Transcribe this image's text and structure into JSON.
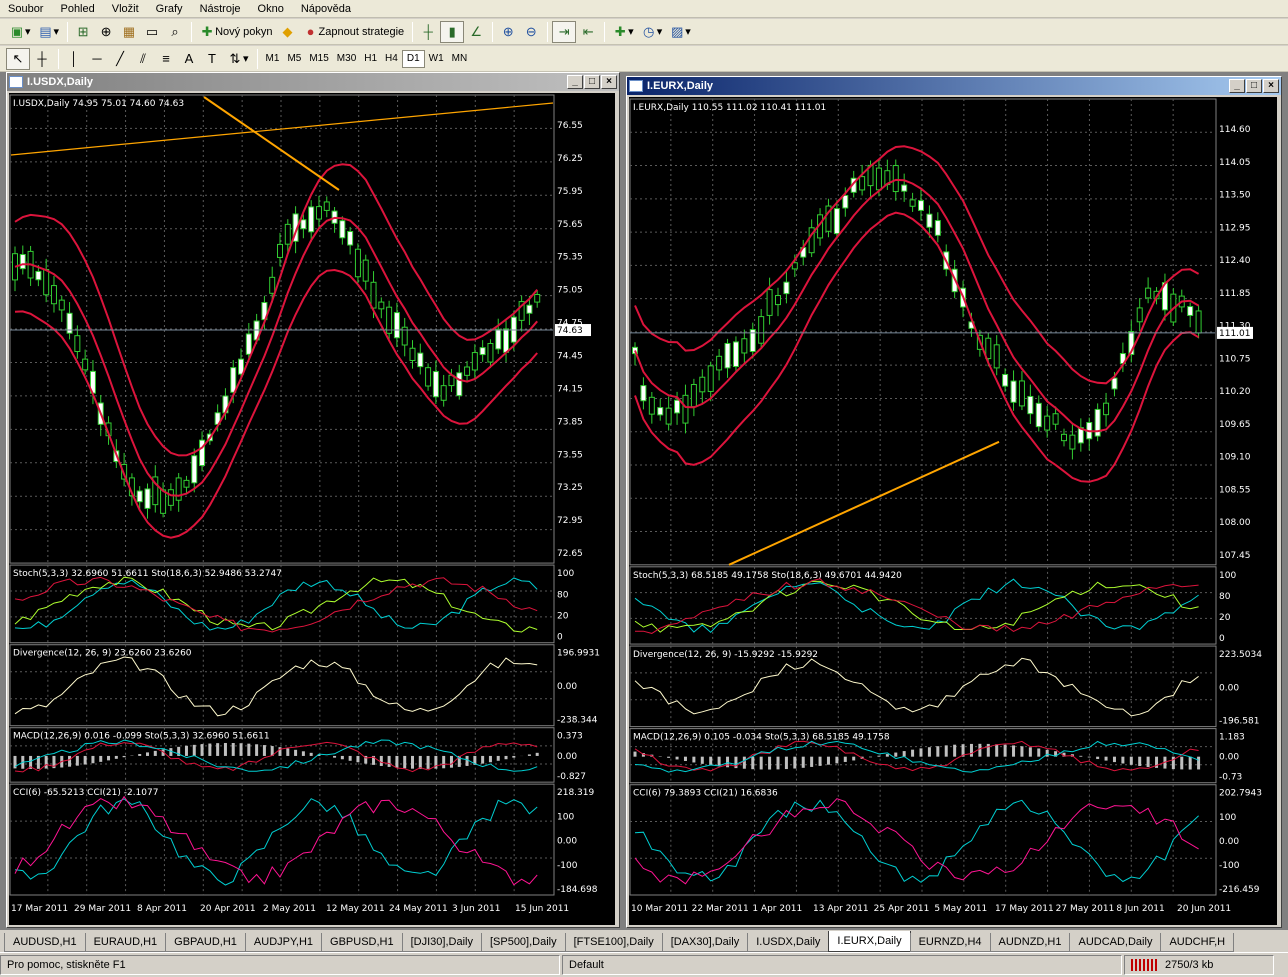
{
  "menu": [
    "Soubor",
    "Pohled",
    "Vložit",
    "Grafy",
    "Nástroje",
    "Okno",
    "Nápověda"
  ],
  "toolbar": {
    "new_order": "Nový pokyn",
    "autotrade": "Zapnout strategie"
  },
  "timeframes": [
    "M1",
    "M5",
    "M15",
    "M30",
    "H1",
    "H4",
    "D1",
    "W1",
    "MN"
  ],
  "active_timeframe": "D1",
  "windows": [
    {
      "title": "I.USDX,Daily",
      "active": false,
      "header": "I.USDX,Daily  74.95 75.01 74.60 74.63",
      "price_ticks": [
        "76.55",
        "76.25",
        "75.95",
        "75.65",
        "75.35",
        "75.05",
        "74.75",
        "74.45",
        "74.15",
        "73.85",
        "73.55",
        "73.25",
        "72.95",
        "72.65"
      ],
      "current_price": "74.63",
      "stoch_label": "Stoch(5,3,3) 32.6960 51.6611  Sto(18,6,3) 52.9486 53.2747",
      "stoch_ticks": [
        "100",
        "80",
        "20",
        "0"
      ],
      "div_label": "Divergence(12, 26, 9) 23.6260 23.6260",
      "div_ticks": [
        "196.9931",
        "0.00",
        "-238.344"
      ],
      "macd_label": "MACD(12,26,9) 0.016 -0.099  Sto(5,3,3) 32.6960 51.6611",
      "macd_ticks": [
        "0.373",
        "0.00",
        "-0.827"
      ],
      "cci_label": "CCI(6) -65.5213  CCI(21) -2.1077",
      "cci_ticks": [
        "218.319",
        "100",
        "0.00",
        "-100",
        "-184.698"
      ],
      "dates": [
        "17 Mar 2011",
        "29 Mar 2011",
        "8 Apr 2011",
        "20 Apr 2011",
        "2 May 2011",
        "12 May 2011",
        "24 May 2011",
        "3 Jun 2011",
        "15 Jun 2011"
      ]
    },
    {
      "title": "I.EURX,Daily",
      "active": true,
      "header": "I.EURX,Daily  110.55 111.02 110.41 111.01",
      "price_ticks": [
        "114.60",
        "114.05",
        "113.50",
        "112.95",
        "112.40",
        "111.85",
        "111.30",
        "110.75",
        "110.20",
        "109.65",
        "109.10",
        "108.55",
        "108.00",
        "107.45"
      ],
      "current_price": "111.01",
      "stoch_label": "Stoch(5,3,3) 68.5185 49.1758  Sto(18,6,3) 49.6701 44.9420",
      "stoch_ticks": [
        "100",
        "80",
        "20",
        "0"
      ],
      "div_label": "Divergence(12, 26, 9) -15.9292 -15.9292",
      "div_ticks": [
        "223.5034",
        "0.00",
        "-196.581"
      ],
      "macd_label": "MACD(12,26,9) 0.105 -0.034  Sto(5,3,3) 68.5185 49.1758",
      "macd_ticks": [
        "1.183",
        "0.00",
        "-0.73"
      ],
      "cci_label": "CCI(6) 79.3893  CCI(21) 16.6836",
      "cci_ticks": [
        "202.7943",
        "100",
        "0.00",
        "-100",
        "-216.459"
      ],
      "dates": [
        "10 Mar 2011",
        "22 Mar 2011",
        "1 Apr 2011",
        "13 Apr 2011",
        "25 Apr 2011",
        "5 May 2011",
        "17 May 2011",
        "27 May 2011",
        "8 Jun 2011",
        "20 Jun 2011"
      ]
    }
  ],
  "tabs": [
    "AUDUSD,H1",
    "EURAUD,H1",
    "GBPAUD,H1",
    "AUDJPY,H1",
    "GBPUSD,H1",
    "[DJI30],Daily",
    "[SP500],Daily",
    "[FTSE100],Daily",
    "[DAX30],Daily",
    "I.USDX,Daily",
    "I.EURX,Daily",
    "EURNZD,H4",
    "AUDNZD,H1",
    "AUDCAD,Daily",
    "AUDCHF,H"
  ],
  "active_tab": "I.EURX,Daily",
  "status": {
    "help": "Pro pomoc, stiskněte F1",
    "profile": "Default",
    "traffic": "2750/3 kb"
  },
  "colors": {
    "chart_bg": "#000000",
    "candle": "#ffffff",
    "bands": "#dc143c",
    "trendline": "#ffa500",
    "grid": "#555555"
  }
}
